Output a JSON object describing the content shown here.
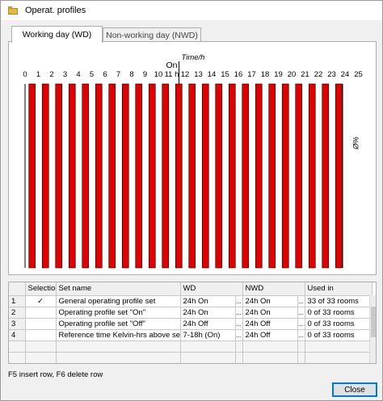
{
  "window": {
    "title": "Operat. profiles"
  },
  "tabs": [
    {
      "label": "Working day (WD)",
      "active": true
    },
    {
      "label": "Non-working day (NWD)",
      "active": false
    }
  ],
  "colors": {
    "bar": "#e00000",
    "bar_outline": "#000000"
  },
  "chart_data": {
    "type": "bar",
    "xlabel": "Time/h",
    "ylabel": "%Ø",
    "xlim": [
      0,
      25
    ],
    "x_ticks": [
      "0",
      "1",
      "2",
      "3",
      "4",
      "5",
      "6",
      "7",
      "8",
      "9",
      "10",
      "11 h",
      "12",
      "13",
      "14",
      "15",
      "16",
      "17",
      "18",
      "19",
      "20",
      "21",
      "22",
      "23",
      "24",
      "25"
    ],
    "annotation": "On",
    "annotation_x": 11,
    "categories": [
      "0",
      "1",
      "2",
      "3",
      "4",
      "5",
      "6",
      "7",
      "8",
      "9",
      "10",
      "11",
      "12",
      "13",
      "14",
      "15",
      "16",
      "17",
      "18",
      "19",
      "20",
      "21",
      "22",
      "23"
    ],
    "values": [
      1,
      1,
      1,
      1,
      1,
      1,
      1,
      1,
      1,
      1,
      1,
      1,
      1,
      1,
      1,
      1,
      1,
      1,
      1,
      1,
      1,
      1,
      1,
      1
    ],
    "ylim": [
      0,
      1
    ]
  },
  "grid": {
    "columns": [
      "",
      "Selection",
      "Set name",
      "WD",
      "",
      "NWD",
      "",
      "Used in"
    ],
    "rows": [
      {
        "num": "1",
        "selection": "✓",
        "name": "General operating profile set",
        "wd": "24h On",
        "wd_btn": "...",
        "nwd": "24h On",
        "nwd_btn": "...",
        "used": "33 of 33 rooms"
      },
      {
        "num": "2",
        "selection": "",
        "name": "Operating profile set \"On\"",
        "wd": "24h On",
        "wd_btn": "...",
        "nwd": "24h On",
        "nwd_btn": "...",
        "used": "0 of 33 rooms"
      },
      {
        "num": "3",
        "selection": "",
        "name": "Operating profile set \"Off\"",
        "wd": "24h Off",
        "wd_btn": "...",
        "nwd": "24h Off",
        "nwd_btn": "...",
        "used": "0 of 33 rooms"
      },
      {
        "num": "4",
        "selection": "",
        "name": "Reference time Kelvin-hrs above set p...",
        "wd": "7-18h (On)",
        "wd_btn": "...",
        "nwd": "24h Off",
        "nwd_btn": "...",
        "used": "0 of 33 rooms"
      }
    ]
  },
  "status": {
    "hint": "F5 insert row, F6 delete row"
  },
  "buttons": {
    "close": "Close"
  }
}
